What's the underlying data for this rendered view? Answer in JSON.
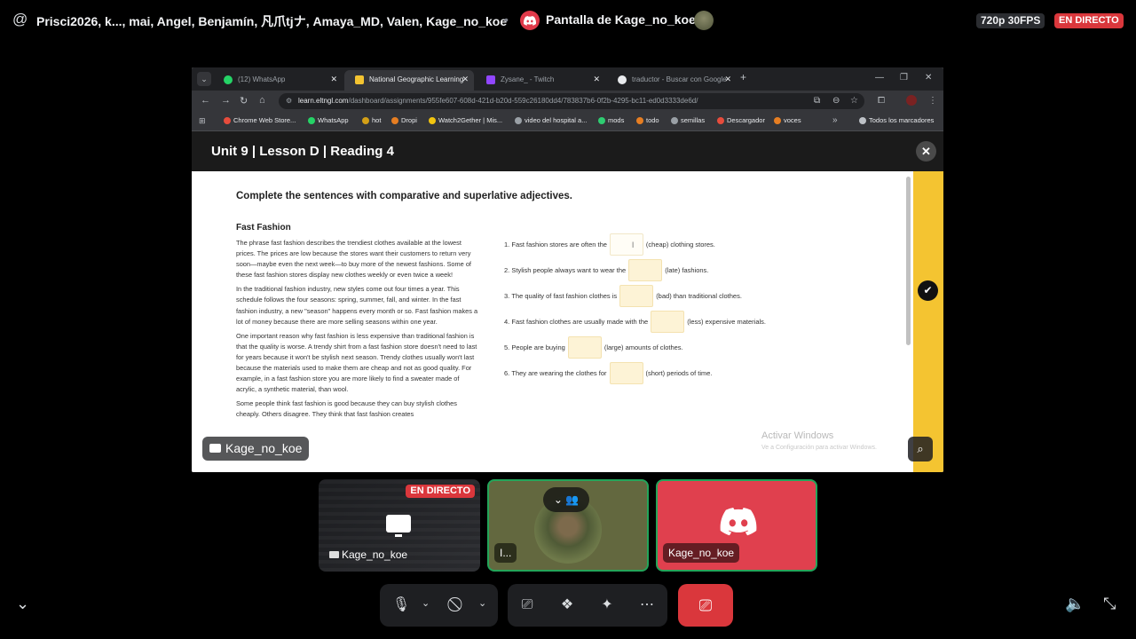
{
  "topbar": {
    "participants": "Prisci2026, k..., mai, Angel, Benjamín, 凡爪tjナ, Amaya_MD, Valen, Kage_no_koe",
    "separator": "•",
    "screen_title": "Pantalla de Kage_no_koe",
    "quality": "720p 30FPS",
    "live": "EN DIRECTO"
  },
  "browser": {
    "tabs": [
      {
        "label": "(12) WhatsApp",
        "icon": "whatsapp-icon",
        "color": "#25d366"
      },
      {
        "label": "National Geographic Learning",
        "icon": "natgeo-icon",
        "color": "#f4c431"
      },
      {
        "label": "Zysane_ - Twitch",
        "icon": "twitch-icon",
        "color": "#9146ff"
      },
      {
        "label": "traductor - Buscar con Google",
        "icon": "google-icon",
        "color": "#e8eaed"
      }
    ],
    "url_host": "learn.eltngl.com",
    "url_path": "/dashboard/assignments/955fe607-608d-421d-b20d-559c26180dd4/783837b6-0f2b-4295-bc11-ed0d3333de6d/",
    "bookmarks": [
      {
        "label": "Chrome Web Store...",
        "color": "#e74c3c"
      },
      {
        "label": "WhatsApp",
        "color": "#25d366"
      },
      {
        "label": "hot",
        "color": "#d4a017"
      },
      {
        "label": "Dropi",
        "color": "#e67e22"
      },
      {
        "label": "Watch2Gether | Mis...",
        "color": "#f1c40f"
      },
      {
        "label": "video del hospital a...",
        "color": "#9aa0a6"
      },
      {
        "label": "mods",
        "color": "#2ecc71"
      },
      {
        "label": "todo",
        "color": "#e67e22"
      },
      {
        "label": "semillas",
        "color": "#9aa0a6"
      },
      {
        "label": "Descargador",
        "color": "#e74c3c"
      },
      {
        "label": "voces",
        "color": "#e67e22"
      }
    ],
    "all_bookmarks": "Todos los marcadores"
  },
  "lesson": {
    "title": "Unit 9 | Lesson D | Reading 4",
    "instruction": "Complete the sentences with comparative and superlative adjectives.",
    "reading_title": "Fast Fashion",
    "paragraphs": [
      "The phrase fast fashion describes the trendiest clothes available at the lowest prices. The prices are low because the stores want their customers to return very soon—maybe even the next week—to buy more of the newest fashions. Some of these fast fashion stores display new clothes weekly or even twice a week!",
      "In the traditional fashion industry, new styles come out four times a year. This schedule follows the four seasons: spring, summer, fall, and winter. In the fast fashion industry, a new \"season\" happens every month or so. Fast fashion makes a lot of money because there are more selling seasons within one year.",
      "One important reason why fast fashion is less expensive than traditional fashion is that the quality is worse. A trendy shirt from a fast fashion store doesn't need to last for years because it won't be stylish next season. Trendy clothes usually won't last because the materials used to make them are cheap and not as good quality. For example, in a fast fashion store you are more likely to find a sweater made of acrylic, a synthetic material, than wool.",
      "Some people think fast fashion is good because they can buy stylish clothes cheaply. Others disagree. They think that fast fashion creates"
    ],
    "questions": [
      {
        "num": "1.",
        "before": "Fast fashion stores are often the",
        "after": "(cheap) clothing stores."
      },
      {
        "num": "2.",
        "before": "Stylish people always want to wear the",
        "after": "(late) fashions."
      },
      {
        "num": "3.",
        "before": "The quality of fast fashion clothes is",
        "after": "(bad) than traditional clothes."
      },
      {
        "num": "4.",
        "before": "Fast fashion clothes are usually made with the",
        "after": "(less) expensive materials."
      },
      {
        "num": "5.",
        "before": "People are buying",
        "after": "(large) amounts of clothes."
      },
      {
        "num": "6.",
        "before": "They are wearing the clothes for",
        "after": "(short) periods of time."
      }
    ],
    "watermark_title": "Activar Windows",
    "watermark_sub": "Ve a Configuración para activar Windows."
  },
  "stream_name_tag": "Kage_no_koe",
  "tiles": [
    {
      "name": "Kage_no_koe",
      "live": "EN DIRECTO"
    },
    {
      "name": "I..."
    },
    {
      "name": "Kage_no_koe"
    }
  ]
}
